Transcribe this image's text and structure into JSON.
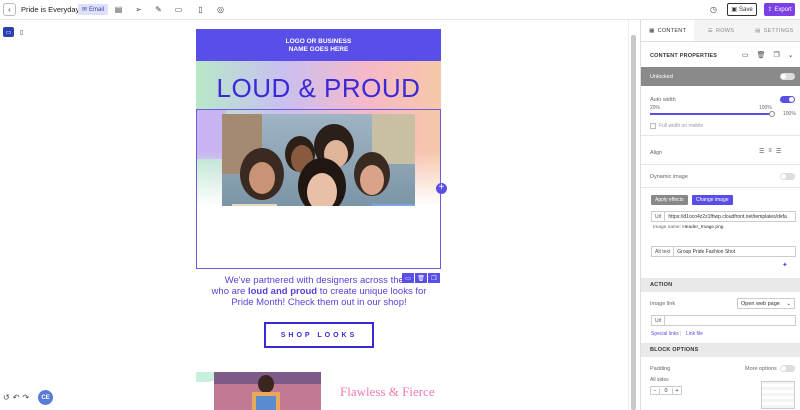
{
  "topbar": {
    "title": "Pride is Everyday",
    "badge": "Email",
    "save_label": "Save",
    "export_label": "Export"
  },
  "email": {
    "logo_text_line1": "LOGO OR BUSINESS",
    "logo_text_line2": "NAME GOES HERE",
    "hero_title": "LOUD & PROUD",
    "body_part1": "We've partnered with designers across the w",
    "body_part2": "who are ",
    "body_bold": "loud and proud",
    "body_part3": " to create unique looks for",
    "body_part4": "Pride Month! Check them out in our shop!",
    "cta_label": "SHOP LOOKS",
    "secondary_heading": "Flawless & Fierce",
    "hero_colors": [
      "#b8e8c8",
      "#c8c0f0",
      "#f6b8c8",
      "#f6c8a8"
    ],
    "accent_color": "#5a4ee8",
    "headline_color": "#3a2ad6",
    "secondary_color": "#f07ab0"
  },
  "footer": {
    "avatar_initials": "CE"
  },
  "panel": {
    "tabs": [
      {
        "label": "CONTENT",
        "icon": "grid-icon",
        "active": true
      },
      {
        "label": "ROWS",
        "icon": "rows-icon",
        "active": false
      },
      {
        "label": "SETTINGS",
        "icon": "settings-icon",
        "active": false
      }
    ],
    "content_properties": "CONTENT PROPERTIES",
    "unlocked": "Unlocked",
    "auto_width": "Auto width",
    "auto_width_on": true,
    "slider_min": "20%",
    "slider_value_label": "100%",
    "slider_max": "100%",
    "slider_fraction": 1.0,
    "full_width_mobile": "Full width on mobile",
    "align": "Align",
    "dynamic_image": "Dynamic image",
    "dynamic_image_on": false,
    "apply_effects": "Apply effects",
    "change_image": "Change image",
    "url_prefix": "Url",
    "image_url": "https://d1oco4z2z1fhwp.cloudfront.net/templates/defa",
    "image_name_label": "Image name:",
    "image_name": "Header_Image.png",
    "alt_text_label": "Alt text",
    "alt_text": "Group Pride Fashion Shot",
    "action_head": "ACTION",
    "image_link": "Image link",
    "image_link_value": "Open web page",
    "url_label": "Url",
    "url_value": "",
    "special_links": "Special links",
    "link_separator": "|",
    "link_file": "Link file",
    "block_options_head": "BLOCK OPTIONS",
    "padding": "Padding",
    "more_options": "More options",
    "all_sides": "All sides",
    "padding_value": "0"
  }
}
